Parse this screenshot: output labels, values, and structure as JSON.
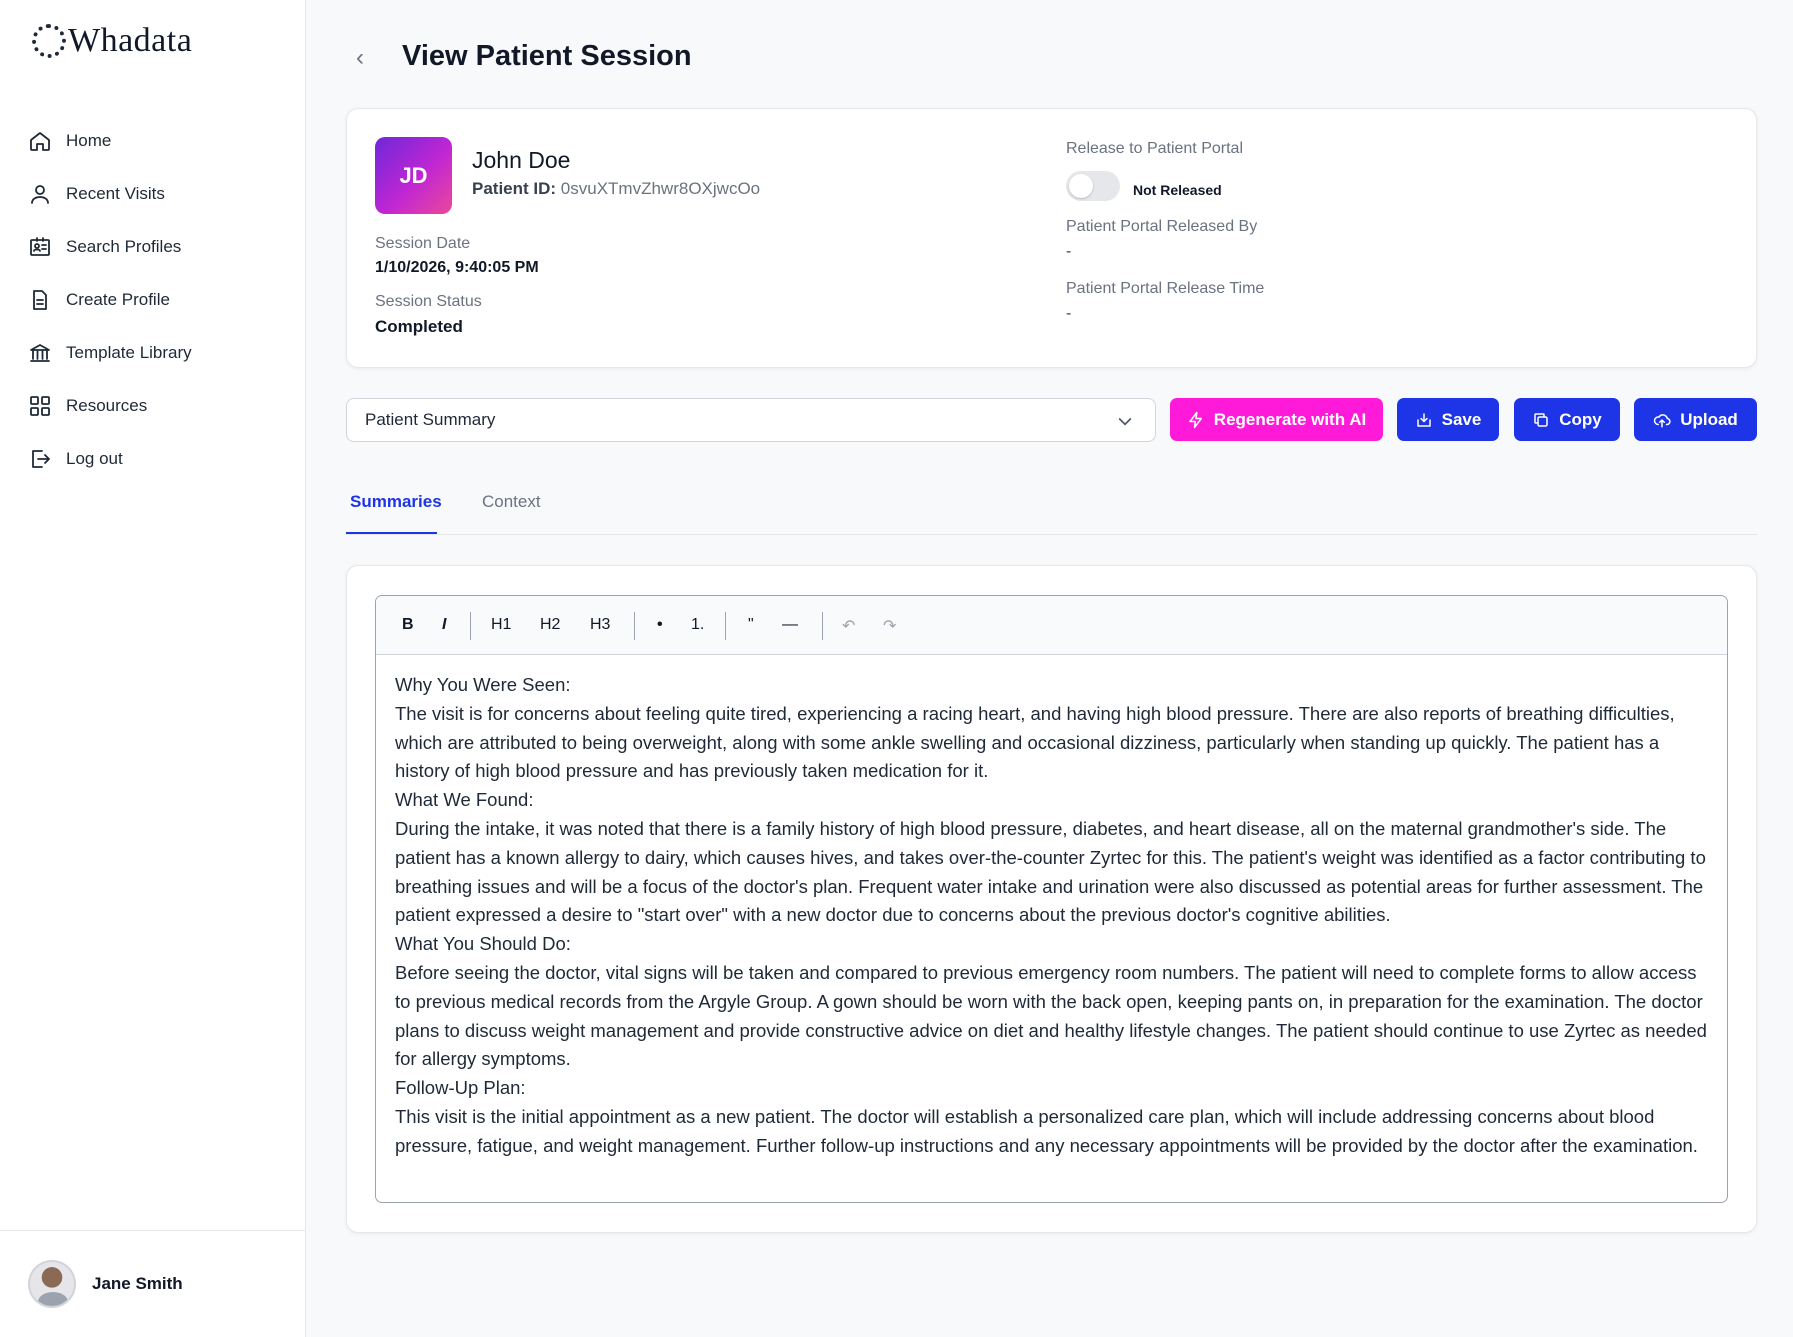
{
  "brand": {
    "name": "Whadata"
  },
  "sidebar": {
    "items": [
      {
        "label": "Home",
        "icon": "home-icon"
      },
      {
        "label": "Recent Visits",
        "icon": "user-icon"
      },
      {
        "label": "Search Profiles",
        "icon": "id-card-icon"
      },
      {
        "label": "Create Profile",
        "icon": "document-icon"
      },
      {
        "label": "Template Library",
        "icon": "library-icon"
      },
      {
        "label": "Resources",
        "icon": "grid-icon"
      },
      {
        "label": "Log out",
        "icon": "logout-icon"
      }
    ],
    "user": {
      "name": "Jane Smith"
    }
  },
  "header": {
    "title": "View Patient Session",
    "back_icon": "chevron-left-icon"
  },
  "patient": {
    "initials": "JD",
    "name": "John Doe",
    "id_label": "Patient ID:",
    "id_value": "0svuXTmvZhwr8OXjwcOo",
    "session_date_label": "Session Date",
    "session_date": "1/10/2026, 9:40:05 PM",
    "session_status_label": "Session Status",
    "session_status": "Completed",
    "release_label": "Release to Patient Portal",
    "release_status": "Not Released",
    "released_by_label": "Patient Portal Released By",
    "released_by": "-",
    "release_time_label": "Patient Portal Release Time",
    "release_time": "-"
  },
  "actions": {
    "template_select": "Patient Summary",
    "regenerate": "Regenerate with AI",
    "save": "Save",
    "copy": "Copy",
    "upload": "Upload"
  },
  "tabs": {
    "summaries": "Summaries",
    "context": "Context"
  },
  "editor": {
    "toolbar": {
      "bold": "B",
      "italic": "I",
      "h1": "H1",
      "h2": "H2",
      "h3": "H3",
      "bullet": "•",
      "ordered": "1.",
      "quote": "\"",
      "rule": "—",
      "undo": "↶",
      "redo": "↷"
    },
    "lines": [
      "Why You Were Seen:",
      "The visit is for concerns about feeling quite tired, experiencing a racing heart, and having high blood pressure. There are also reports of breathing difficulties, which are attributed to being overweight, along with some ankle swelling and occasional dizziness, particularly when standing up quickly. The patient has a history of high blood pressure and has previously taken medication for it.",
      "What We Found:",
      "During the intake, it was noted that there is a family history of high blood pressure, diabetes, and heart disease, all on the maternal grandmother's side. The patient has a known allergy to dairy, which causes hives, and takes over-the-counter Zyrtec for this. The patient's weight was identified as a factor contributing to breathing issues and will be a focus of the doctor's plan. Frequent water intake and urination were also discussed as potential areas for further assessment. The patient expressed a desire to \"start over\" with a new doctor due to concerns about the previous doctor's cognitive abilities.",
      "What You Should Do:",
      "Before seeing the doctor, vital signs will be taken and compared to previous emergency room numbers. The patient will need to complete forms to allow access to previous medical records from the Argyle Group. A gown should be worn with the back open, keeping pants on, in preparation for the examination. The doctor plans to discuss weight management and provide constructive advice on diet and healthy lifestyle changes. The patient should continue to use Zyrtec as needed for allergy symptoms.",
      "Follow-Up Plan:",
      "This visit is the initial appointment as a new patient. The doctor will establish a personalized care plan, which will include addressing concerns about blood pressure, fatigue, and weight management. Further follow-up instructions and any necessary appointments will be provided by the doctor after the examination."
    ]
  },
  "colors": {
    "primary": "#1d35e6",
    "ai": "#ff1ad9",
    "avatar_from": "#6d28d9",
    "avatar_to": "#ec4899"
  }
}
